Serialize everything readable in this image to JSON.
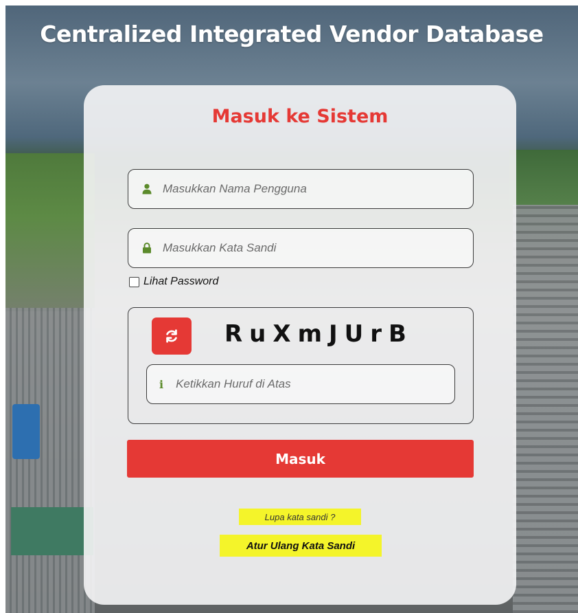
{
  "header": {
    "title": "Centralized Integrated Vendor Database"
  },
  "login": {
    "title": "Masuk ke Sistem",
    "username_placeholder": "Masukkan Nama Pengguna",
    "password_placeholder": "Masukkan Kata Sandi",
    "show_password_label": "Lihat Password",
    "show_password_checked": false,
    "captcha_text": "RuXmJUrB",
    "captcha_input_placeholder": "Ketikkan Huruf di Atas",
    "submit_label": "Masuk",
    "forgot_label": "Lupa kata sandi ?",
    "reset_label": "Atur Ulang Kata Sandi"
  },
  "icons": {
    "username": "user-icon",
    "password": "lock-icon",
    "refresh": "refresh-icon",
    "captcha_info": "info-icon"
  },
  "colors": {
    "accent": "#e53935",
    "icon_green": "#5b8a2a",
    "highlight": "#f4f42a"
  }
}
